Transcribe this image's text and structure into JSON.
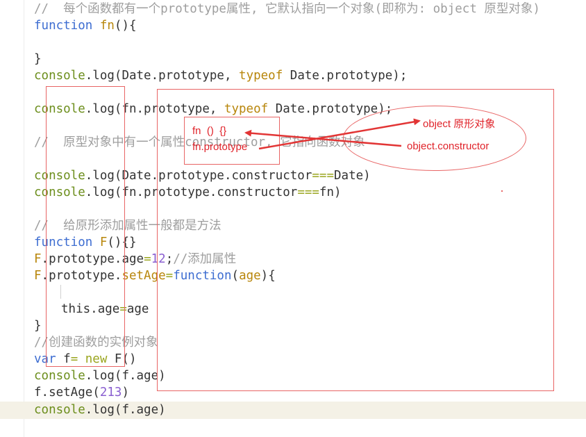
{
  "code": {
    "line1": "//  每个函数都有一个prototype属性, 它默认指向一个对象(即称为: object 原型对象)",
    "line2": {
      "kw": "function",
      "name": "fn",
      "rest": "(){"
    },
    "line4": "}",
    "line5": {
      "a": "console",
      "b": ".log(Date.prototype, ",
      "c": "typeof",
      "d": " Date.prototype);"
    },
    "line7": {
      "a": "console",
      "b": ".log(fn.prototype, ",
      "c": "typeof",
      "d": " Date.prototype);"
    },
    "line9": "//  原型对象中有一个属性constructor, 它指向函数对象",
    "line11": {
      "a": "console",
      "b": ".log(Date.prototype.constructor",
      "c": "===",
      "d": "Date)"
    },
    "line12": {
      "a": "console",
      "b": ".log(fn.prototype.constructor",
      "c": "===",
      "d": "fn)"
    },
    "line14": "//  给原形添加属性一般都是方法",
    "line15": {
      "kw": "function",
      "name": "F",
      "rest": "(){}"
    },
    "line16": {
      "a": "F",
      "b": ".prototype.age",
      "c": "=",
      "d": "12",
      "e": ";",
      "f": "//添加属性"
    },
    "line17": {
      "a": "F",
      "b": ".prototype.",
      "c": "setAge",
      "d": "=",
      "e": "function",
      "f": "(",
      "g": "age",
      "h": "){"
    },
    "line19": {
      "a": "this",
      "b": ".age",
      "c": "=",
      "d": "age"
    },
    "line20": "}",
    "line21": "//创建函数的实例对象",
    "line22": {
      "a": "var",
      "b": " f",
      "c": "= ",
      "d": "new",
      "e": " F()"
    },
    "line23": {
      "a": "console",
      "b": ".log(f.age)"
    },
    "line24": {
      "a": "f.setAge(",
      "b": "213",
      "c": ")"
    },
    "line25": {
      "a": "console",
      "b": ".log(f.age)"
    }
  },
  "annotations": {
    "fn_label": "fn  ()  {}",
    "fn_prototype_label": "fn.prototype",
    "object_label": "object 原形对象",
    "constructor_label": "object.constructor",
    "annotation_color": "#e86464"
  }
}
